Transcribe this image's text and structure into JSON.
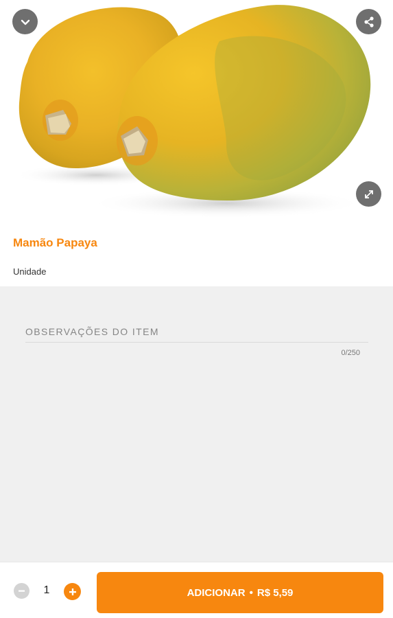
{
  "product": {
    "name": "Mamão Papaya",
    "unit": "Unidade"
  },
  "notes": {
    "placeholder": "OBSERVAÇÕES DO ITEM",
    "counter": "0/250"
  },
  "quantity": {
    "value": "1"
  },
  "add_button": {
    "label": "ADICIONAR",
    "separator": "•",
    "price": "R$ 5,59"
  },
  "icons": {
    "collapse": "chevron-down-icon",
    "share": "share-icon",
    "expand": "expand-icon",
    "minus": "minus-icon",
    "plus": "plus-icon"
  },
  "colors": {
    "accent": "#f7870f",
    "overlay_button": "#6f6f6f",
    "notes_background": "#f0f0f0",
    "disabled": "#d3d3d3"
  }
}
